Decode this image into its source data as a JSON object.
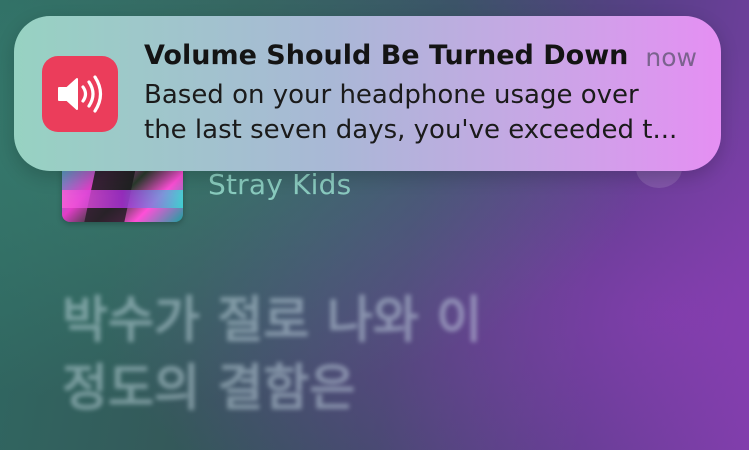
{
  "notification": {
    "app_icon": "speaker-volume-icon",
    "icon_color": "#eb3d5b",
    "title": "Volume Should Be Turned Down",
    "time": "now",
    "body_line1": "Based on your headphone usage over",
    "body_line2": "the last seven days, you've exceeded t..."
  },
  "now_playing": {
    "artist": "Stray Kids",
    "lyrics_line1": "박수가 절로 나와 이",
    "lyrics_line2": "정도의 결함은"
  }
}
